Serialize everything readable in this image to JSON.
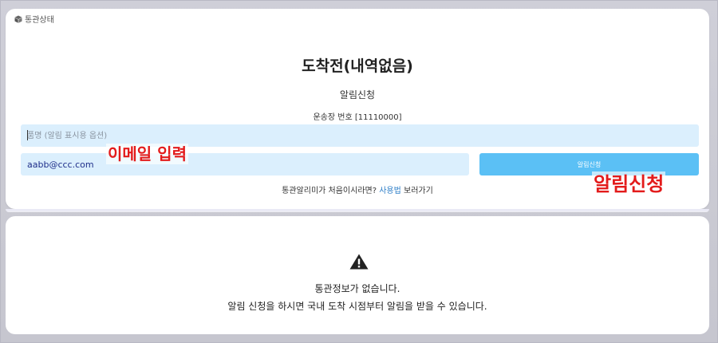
{
  "section": {
    "label": "통관상태",
    "icon": "cube-icon"
  },
  "status": {
    "title": "도착전(내역없음)",
    "subtitle": "알림신청",
    "tracking_text": "운송장 번호 [11110000]"
  },
  "form": {
    "product_placeholder": "품명 (알림 표시용 옵션)",
    "product_value": "",
    "email_value": "aabb@ccc.com",
    "apply_label": "알림신청"
  },
  "annotations": {
    "email": "이메일 입력",
    "apply": "알림신청",
    "color": "#e31b1b"
  },
  "help": {
    "prefix": "통관알리미가 처음이시라면? ",
    "link": "사용법",
    "suffix": " 보러가기"
  },
  "empty_state": {
    "icon": "warning-icon",
    "line1": "통관정보가 없습니다.",
    "line2": "알림 신청을 하시면 국내 도착 시점부터 알림을 받을 수 있습니다."
  },
  "colors": {
    "accent_button": "#5bc0f5",
    "input_background": "#dbeffd",
    "link": "#2f7fc8"
  }
}
